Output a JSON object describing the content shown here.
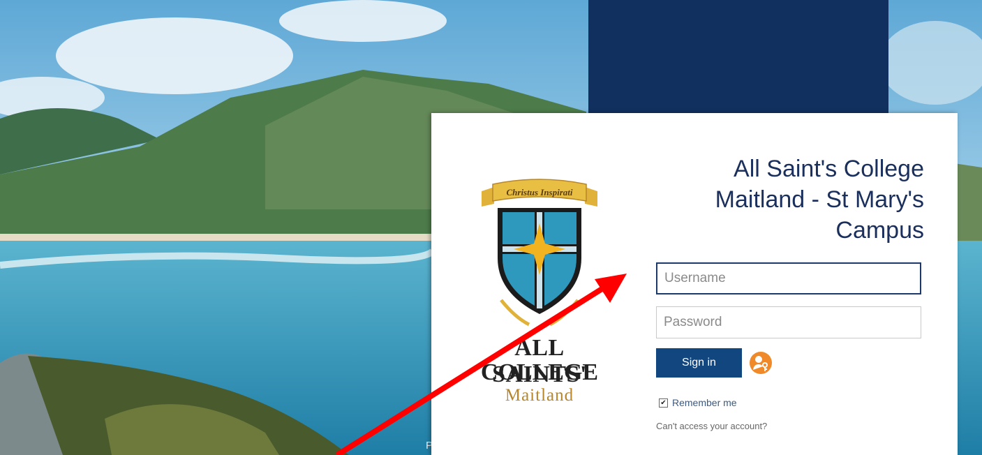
{
  "college": {
    "title_lines": [
      "All Saint's College",
      "Maitland - St Mary's",
      "Campus"
    ],
    "logo_motto": "Christus Inspirati",
    "logo_lines": [
      "ALL SAINTS'",
      "COLLEGE",
      "Maitland"
    ]
  },
  "form": {
    "username_placeholder": "Username",
    "password_placeholder": "Password",
    "signin_label": "Sign in",
    "remember_label": "Remember me",
    "cant_access_label": "Can't access your account?",
    "remember_checked": true
  },
  "background": {
    "peek_text": "P"
  },
  "colors": {
    "navy": "#11305f",
    "title": "#1a2f5c",
    "button": "#12467f",
    "sso": "#f0892a",
    "arrow": "#ff0000"
  },
  "icons": {
    "sso": "key-user-icon",
    "checkbox": "checkmark-icon"
  }
}
